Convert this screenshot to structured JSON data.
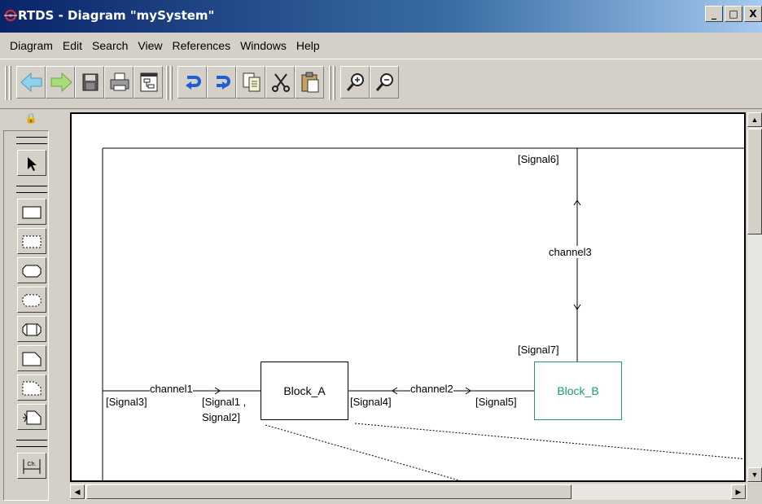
{
  "window": {
    "title": "RTDS - Diagram \"mySystem\"",
    "controls": [
      "_",
      "□",
      "X"
    ]
  },
  "menu": [
    "Diagram",
    "Edit",
    "Search",
    "View",
    "References",
    "Windows",
    "Help"
  ],
  "toolbar": {
    "buttons": [
      "back-arrow-icon",
      "forward-arrow-icon",
      "save-icon",
      "print-icon",
      "diagram-window-icon",
      "undo-icon",
      "redo-icon",
      "copy-icon",
      "cut-icon",
      "paste-icon",
      "zoom-in-icon",
      "zoom-out-icon"
    ]
  },
  "palette": {
    "lock_glyph": "🔒",
    "tools": [
      "select-arrow-icon",
      "block-icon",
      "dashed-block-icon",
      "process-icon",
      "dashed-process-icon",
      "block-class-icon",
      "comment-icon",
      "dashed-comment-icon",
      "gate-icon",
      "channel-icon"
    ],
    "channel_tool_label": "Ch."
  },
  "diagram": {
    "blocks": [
      {
        "name": "Block_A",
        "color": "#000000"
      },
      {
        "name": "Block_B",
        "color": "#1a9c7a"
      }
    ],
    "channels": {
      "channel1": "channel1",
      "channel2": "channel2",
      "channel3": "channel3"
    },
    "signals": {
      "signal3": "[Signal3]",
      "signal1_2_line1": "[Signal1 ,",
      "signal1_2_line2": "Signal2]",
      "signal4": "[Signal4]",
      "signal5": "[Signal5]",
      "signal6": "[Signal6]",
      "signal7": "[Signal7]"
    }
  }
}
